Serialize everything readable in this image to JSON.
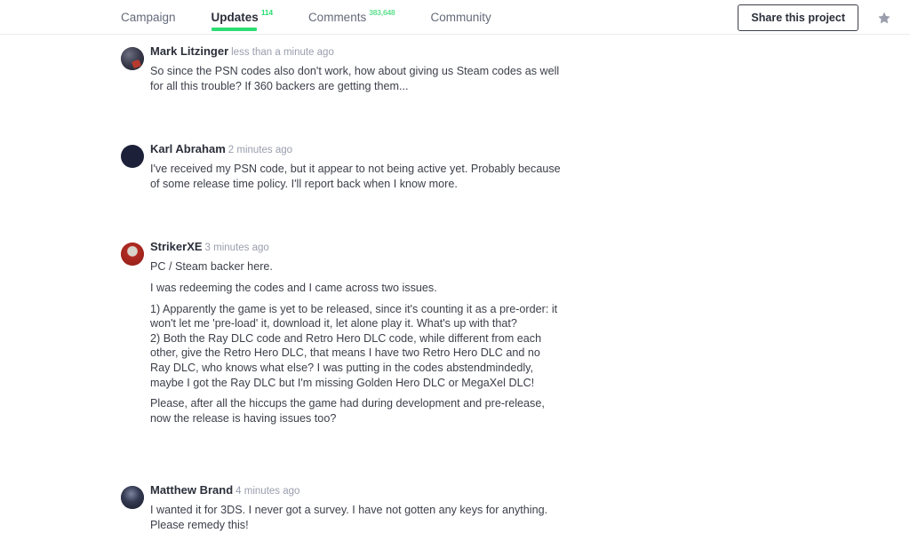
{
  "nav": {
    "tabs": [
      {
        "label": "Campaign",
        "count": null,
        "active": false
      },
      {
        "label": "Updates",
        "count": "114",
        "active": true
      },
      {
        "label": "Comments",
        "count": "383,648",
        "active": false
      },
      {
        "label": "Community",
        "count": null,
        "active": false
      }
    ],
    "share_label": "Share this project",
    "star_icon": "star-icon",
    "accent_color": "#2bde73"
  },
  "comments": [
    {
      "author": "Mark Litzinger",
      "time": "less than a minute ago",
      "avatar_color": "#2e2f3d",
      "avatar_accent": "#b63a2e",
      "paragraphs": [
        "So since the PSN codes also don't work, how about giving us Steam codes as well for all this trouble? If 360 backers are getting them..."
      ]
    },
    {
      "author": "Karl Abraham",
      "time": "2 minutes ago",
      "avatar_color": "#1c2038",
      "avatar_accent": "#3a4470",
      "paragraphs": [
        "I've received my PSN code, but it appear to not being active yet. Probably because of some release time policy. I'll report back when I know more."
      ]
    },
    {
      "author": "StrikerXE",
      "time": "3 minutes ago",
      "avatar_color": "#b02a22",
      "avatar_accent": "#d8d4cc",
      "paragraphs": [
        "PC / Steam backer here.",
        "I was redeeming the codes and I came across two issues.",
        "1) Apparently the game is yet to be released, since it's counting it as a pre-order: it won't let me 'pre-load' it, download it, let alone play it. What's up with that?\n2) Both the Ray DLC code and Retro Hero DLC code, while different from each other, give the Retro Hero DLC, that means I have two Retro Hero DLC and no Ray DLC, who knows what else? I was putting in the codes abstendmindedly, maybe I got the Ray DLC but I'm missing Golden Hero DLC or MegaXel DLC!",
        "Please, after all the hiccups the game had during development and pre-release, now the release is having issues too?"
      ]
    },
    {
      "author": "Matthew Brand",
      "time": "4 minutes ago",
      "avatar_color": "#22263a",
      "avatar_accent": "#5a6080",
      "paragraphs": [
        "I wanted it for 3DS. I never got a survey. I have not gotten any keys for anything. Please remedy this!"
      ]
    }
  ]
}
